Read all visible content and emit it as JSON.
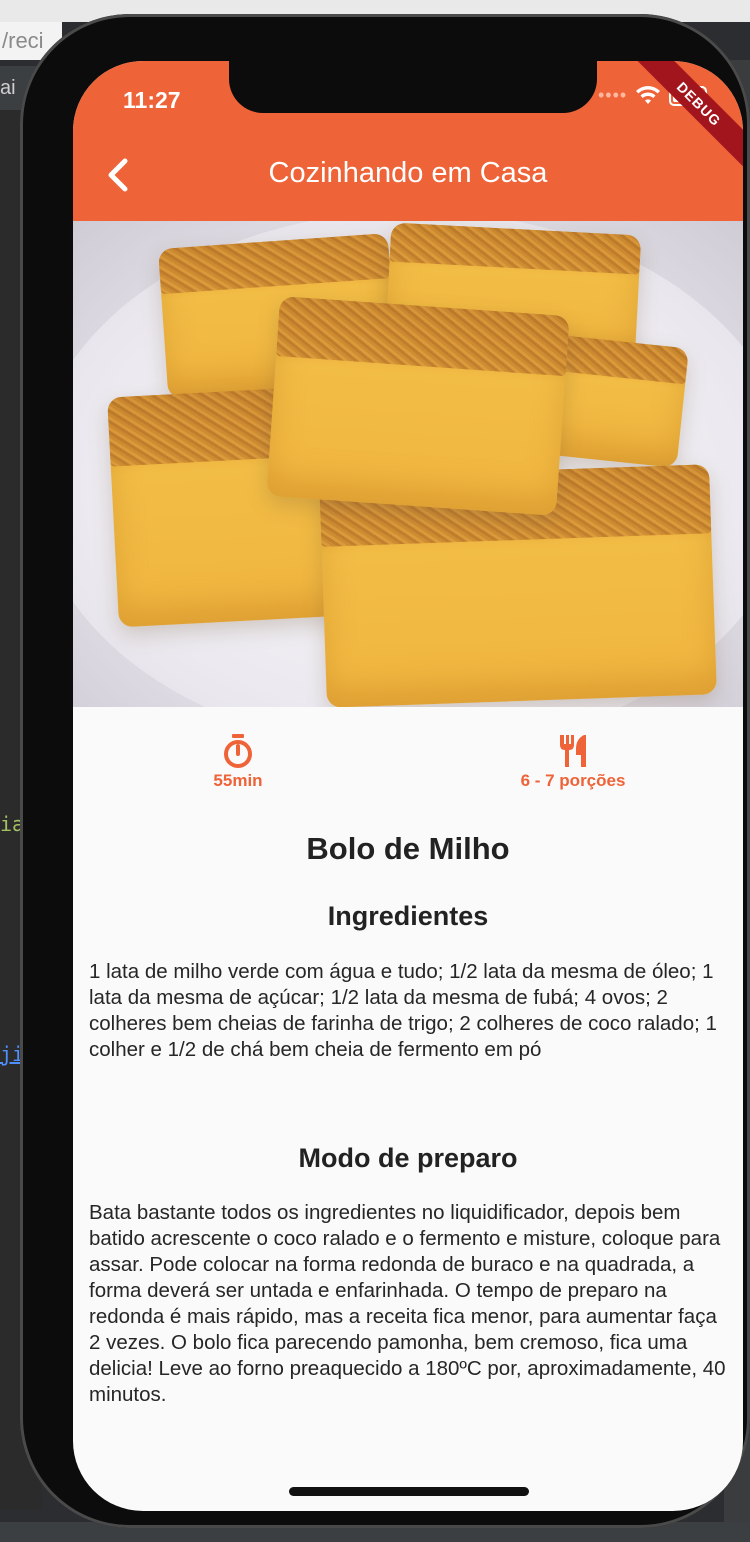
{
  "status_bar": {
    "time": "11:27"
  },
  "debug_banner": "DEBUG",
  "app_bar": {
    "title": "Cozinhando em Casa",
    "back_icon": "chevron-left-icon"
  },
  "hero_image": {
    "alt": "Bolo de Milho"
  },
  "info": {
    "time": {
      "icon": "timer-icon",
      "label": "55min"
    },
    "servings": {
      "icon": "restaurant-icon",
      "label": "6 - 7 porções"
    }
  },
  "recipe": {
    "title": "Bolo de Milho",
    "ingredients_title": "Ingredientes",
    "ingredients_text": "1 lata de milho verde com água e tudo; 1/2 lata da mesma de óleo; 1 lata da mesma de açúcar; 1/2 lata da mesma de fubá; 4 ovos; 2 colheres bem cheias de farinha de trigo; 2 colheres de coco ralado; 1 colher e 1/2 de chá bem cheia de fermento em pó",
    "preparation_title": "Modo de preparo",
    "preparation_text": "Bata bastante todos os ingredientes no liquidificador, depois bem batido acrescente o coco ralado e o fermento e misture, coloque para assar. Pode colocar na forma redonda de buraco e na quadrada, a forma deverá ser untada e enfarinhada. O tempo de preparo na redonda é mais rápido, mas a receita fica menor, para aumentar faça 2 vezes. O bolo fica parecendo pamonha, bem cremoso, fica uma delicia! Leve ao forno preaquecido a 180ºC por, aproximadamente, 40 minutos."
  },
  "background": {
    "url_fragment": "/reci",
    "tab_fragment": "ai",
    "code_fragment_1": "ia",
    "code_fragment_2": "ji"
  },
  "colors": {
    "accent": "#ee6338",
    "debug": "#a3151d",
    "text": "#222222"
  }
}
